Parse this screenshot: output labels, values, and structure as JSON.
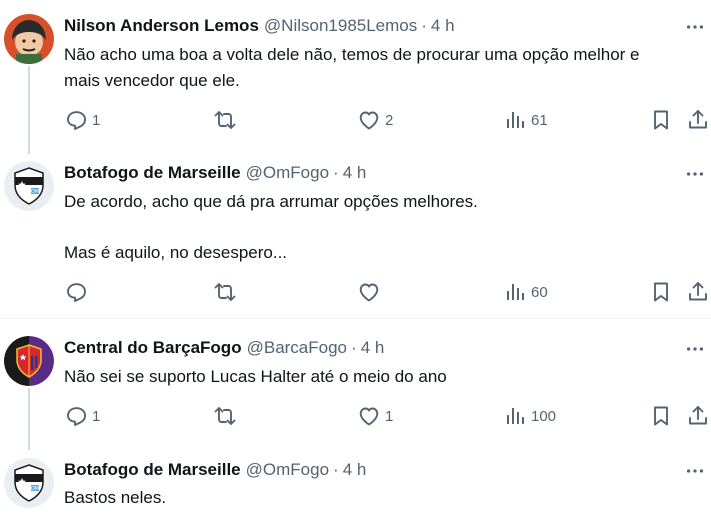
{
  "tweets": [
    {
      "name": "Nilson Anderson Lemos",
      "handle": "@Nilson1985Lemos",
      "separator": "·",
      "time": "4 h",
      "lines": [
        "Não acho uma boa a volta dele não, temos de procurar uma opção melhor e",
        "mais vencedor que ele."
      ],
      "replies": "1",
      "retweets": "",
      "likes": "2",
      "views": "61"
    },
    {
      "name": "Botafogo de Marseille",
      "handle": "@OmFogo",
      "separator": "·",
      "time": "4 h",
      "lines": [
        "De acordo, acho que dá pra arrumar opções melhores.",
        "Mas é aquilo, no desespero..."
      ],
      "replies": "",
      "retweets": "",
      "likes": "",
      "views": "60"
    },
    {
      "name": "Central do BarçaFogo",
      "handle": "@BarcaFogo",
      "separator": "·",
      "time": "4 h",
      "lines": [
        "Não sei se suporto Lucas Halter até o meio do ano"
      ],
      "replies": "1",
      "retweets": "",
      "likes": "1",
      "views": "100"
    },
    {
      "name": "Botafogo de Marseille",
      "handle": "@OmFogo",
      "separator": "·",
      "time": "4 h",
      "lines": [
        "Bastos neles."
      ]
    }
  ],
  "icons": {
    "reply": "reply-icon",
    "retweet": "retweet-icon",
    "like": "heart-icon",
    "views": "views-icon",
    "bookmark": "bookmark-icon",
    "share": "share-icon",
    "more": "more-icon"
  },
  "colors": {
    "text": "#0f1419",
    "secondary": "#536471",
    "thread_line": "#cfd9de",
    "separator": "#eff3f4"
  }
}
